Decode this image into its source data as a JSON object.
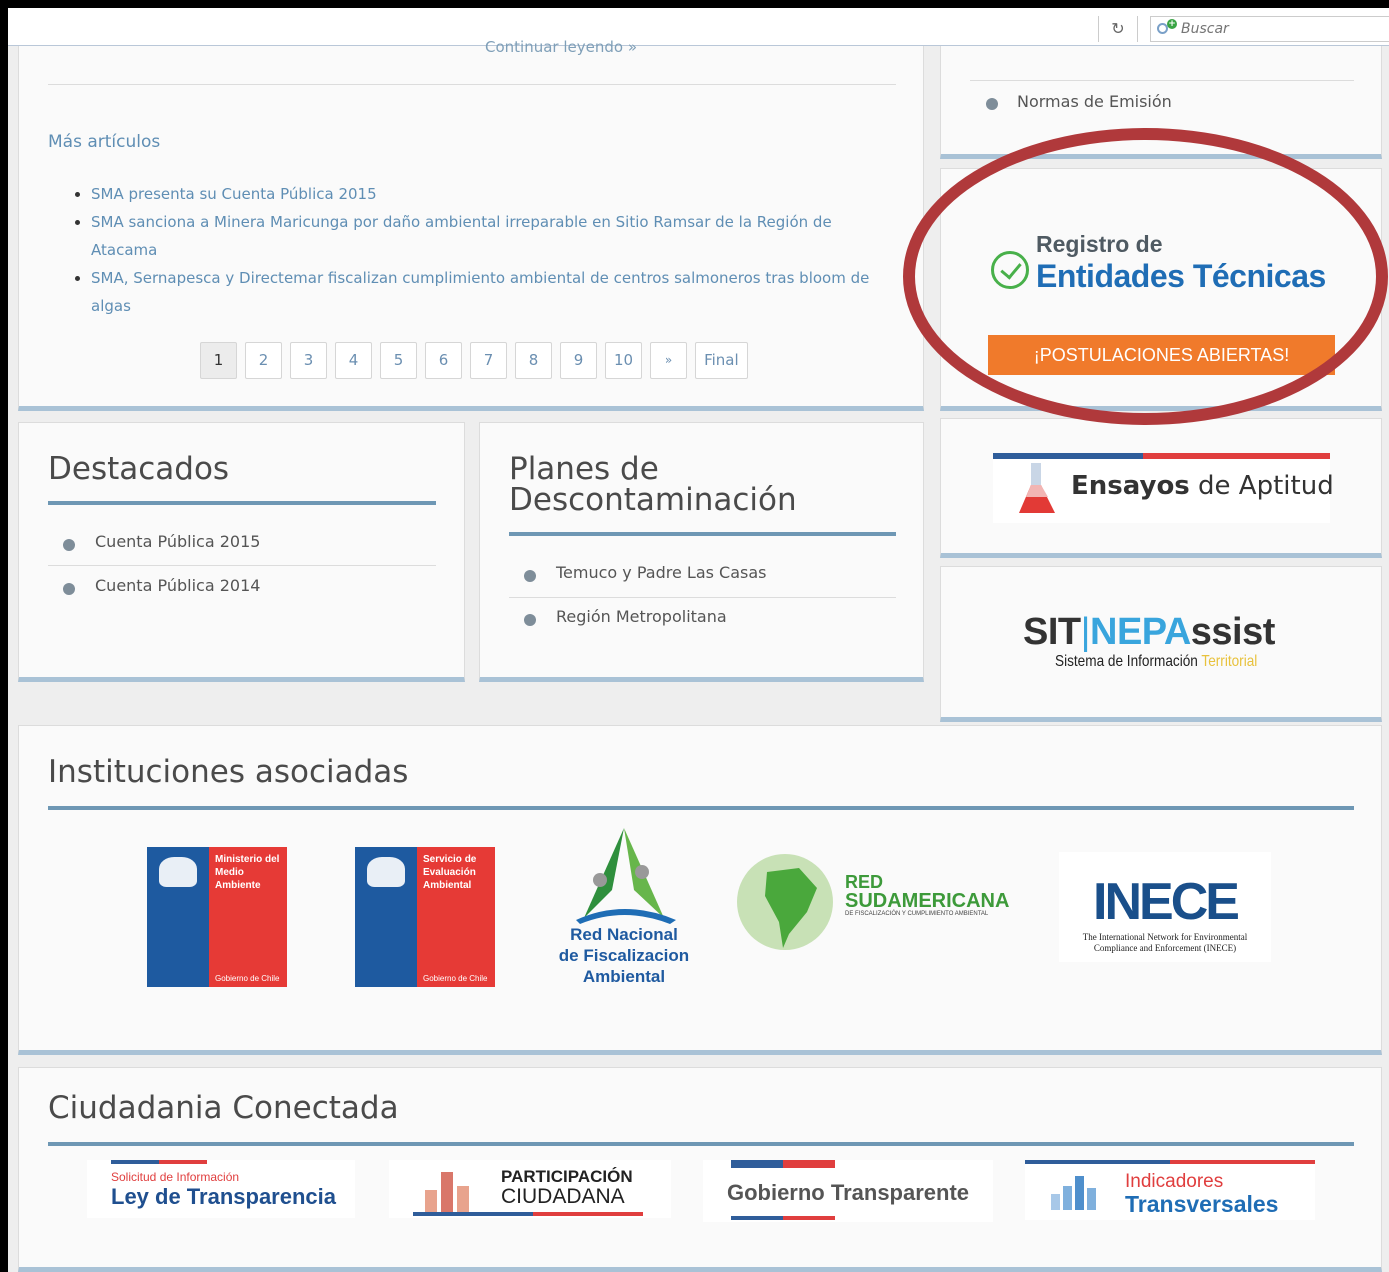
{
  "browser": {
    "search_placeholder": "Buscar",
    "reload_icon": "reload-icon"
  },
  "articles": {
    "continue_link": "Continuar leyendo »",
    "more_title": "Más artículos",
    "items": [
      "SMA presenta su Cuenta Pública 2015",
      "SMA sanciona a Minera Maricunga por daño ambiental irreparable en Sitio Ramsar de la Región de Atacama",
      "SMA, Sernapesca y Directemar fiscalizan cumplimiento ambiental de centros salmoneros tras bloom de algas"
    ],
    "pages": [
      "1",
      "2",
      "3",
      "4",
      "5",
      "6",
      "7",
      "8",
      "9",
      "10",
      "»",
      "Final"
    ],
    "active_page": "1"
  },
  "normas": {
    "item": "Normas de Emisión"
  },
  "registro": {
    "line1": "Registro de",
    "line2": "Entidades Técnicas",
    "button": "¡POSTULACIONES ABIERTAS!",
    "highlight_color": "#b0393b"
  },
  "destacados": {
    "title": "Destacados",
    "items": [
      "Cuenta Pública 2015",
      "Cuenta Pública 2014"
    ]
  },
  "planes": {
    "title_line1": "Planes de",
    "title_line2": "Descontaminación",
    "items": [
      "Temuco y Padre Las Casas",
      "Región Metropolitana"
    ]
  },
  "ensayos": {
    "bold": "Ensayos",
    "rest": " de Aptitud"
  },
  "sit": {
    "sit": "SIT",
    "sep": "|",
    "nepa": "NEPA",
    "ssist": "ssist",
    "sub1": "Sistema de Información ",
    "sub2": "Territorial"
  },
  "instituciones": {
    "title": "Instituciones asociadas",
    "mma": {
      "text": "Ministerio del Medio Ambiente",
      "gov": "Gobierno de Chile"
    },
    "sea": {
      "text": "Servicio de Evaluación Ambiental",
      "gov": "Gobierno de Chile"
    },
    "red_nacional": [
      "Red Nacional",
      "de Fiscalizacion",
      "Ambiental"
    ],
    "red_sud": {
      "l1": "RED",
      "l2": "SUDAMERICANA",
      "l3": "DE FISCALIZACIÓN Y CUMPLIMIENTO AMBIENTAL"
    },
    "inece": {
      "logo": "INECE",
      "l1": "The International Network for Environmental",
      "l2": "Compliance and Enforcement (INECE)"
    }
  },
  "ciudadania": {
    "title": "Ciudadania Conectada",
    "ley": {
      "small": "Solicitud de Información",
      "big": "Ley de Transparencia"
    },
    "participacion": {
      "l1": "PARTICIPACIÓN",
      "l2": "CIUDADANA"
    },
    "gobierno": "Gobierno Transparente",
    "indicadores": {
      "l1": "Indicadores",
      "l2": "Transversales"
    }
  },
  "colors": {
    "accent_blue": "#1f6db5",
    "link_blue": "#5f8eb4",
    "orange": "#f07a2b",
    "rule": "#6e97b4"
  }
}
